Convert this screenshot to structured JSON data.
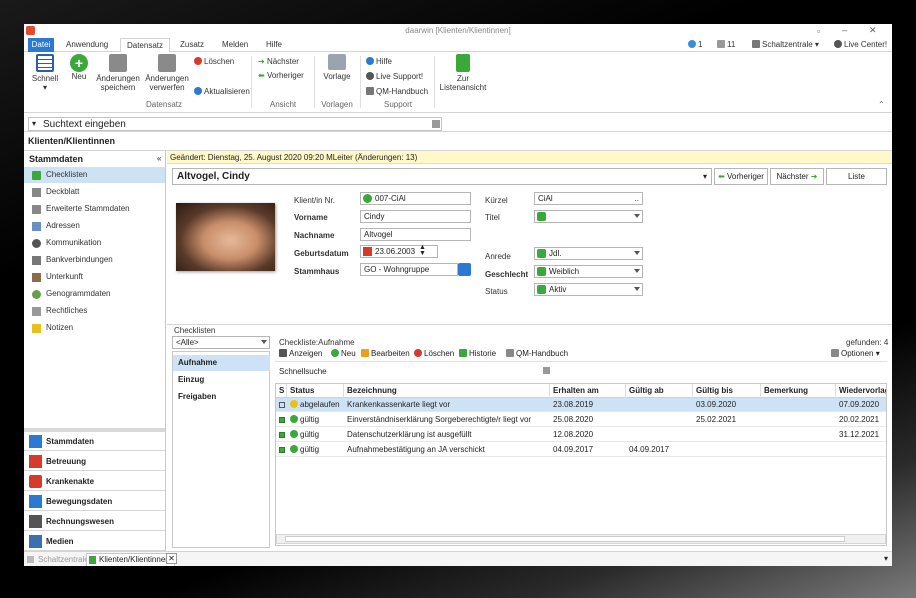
{
  "window": {
    "title": "daarwin [Klienten/Klientinnen]"
  },
  "ribbon_tabs": [
    "Datei",
    "Anwendung",
    "Datensatz",
    "Zusatz",
    "Melden",
    "Hilfe"
  ],
  "top_right": {
    "count1": "1",
    "count2": "11",
    "schaltzentrale": "Schaltzentrale",
    "live_center": "Live Center!"
  },
  "ribbon": {
    "schnell": "Schnell",
    "neu": "Neu",
    "aenderungen_speichern": "Änderungen speichern",
    "aenderungen_verwerfen": "Änderungen verwerfen",
    "loeschen": "Löschen",
    "aktualisieren": "Aktualisieren",
    "naechster": "Nächster",
    "vorheriger": "Vorheriger",
    "vorlage": "Vorlage",
    "hilfe": "Hilfe",
    "live_support": "Live Support!",
    "qm_handbuch": "QM-Handbuch",
    "zur_listenansicht": "Zur Listenansicht",
    "groups": {
      "datensatz": "Datensatz",
      "ansicht": "Ansicht",
      "vorlagen": "Vorlagen",
      "support": "Support"
    }
  },
  "search": {
    "placeholder": "Suchtext eingeben"
  },
  "module_title": "Klienten/Klientinnen",
  "sidebar": {
    "header": "Stammdaten",
    "items": [
      "Checklisten",
      "Deckblatt",
      "Erweiterte Stammdaten",
      "Adressen",
      "Kommunikation",
      "Bankverbindungen",
      "Unterkunft",
      "Genogrammdaten",
      "Rechtliches",
      "Notizen"
    ],
    "nav": [
      "Stammdaten",
      "Betreuung",
      "Krankenakte",
      "Bewegungsdaten",
      "Rechnungswesen",
      "Medien"
    ]
  },
  "changed_info": "Geändert: Dienstag, 25. August 2020 09:20  MLeiter  (Änderungen: 13)",
  "record": {
    "name": "Altvogel, Cindy",
    "vorheriger": "Vorheriger",
    "naechster": "Nächster",
    "liste": "Liste"
  },
  "form": {
    "klient_nr_label": "Klient/in Nr.",
    "klient_nr": "007-CiAl",
    "vorname_label": "Vorname",
    "vorname": "Cindy",
    "nachname_label": "Nachname",
    "nachname": "Altvogel",
    "geburtsdatum_label": "Geburtsdatum",
    "geburtsdatum": "23.06.2003",
    "stammhaus_label": "Stammhaus",
    "stammhaus": "GO - Wohngruppe",
    "kuerzel_label": "Kürzel",
    "kuerzel": "CiAl",
    "titel_label": "Titel",
    "titel": "",
    "anrede_label": "Anrede",
    "anrede": "Jdl.",
    "geschlecht_label": "Geschlecht",
    "geschlecht": "Weiblich",
    "status_label": "Status",
    "status": "Aktiv"
  },
  "checklisten": {
    "header": "Checklisten",
    "filter": "<Alle>",
    "categories": [
      "Aufnahme",
      "Einzug",
      "Freigaben"
    ],
    "panel_title": "Checkliste:Aufnahme",
    "found": "gefunden: 4",
    "toolbar": {
      "anzeigen": "Anzeigen",
      "neu": "Neu",
      "bearbeiten": "Bearbeiten",
      "loeschen": "Löschen",
      "historie": "Historie",
      "qm": "QM-Handbuch",
      "optionen": "Optionen"
    },
    "schnellsuche": "Schnellsuche",
    "columns": [
      "S",
      "Status",
      "Bezeichnung",
      "Erhalten am",
      "Gültig ab",
      "Gültig bis",
      "Bemerkung",
      "Wiedervorlage"
    ],
    "rows": [
      {
        "status": "abgelaufen",
        "color": "#e8c21a",
        "bezeichnung": "Krankenkassenkarte liegt vor",
        "erhalten": "23.08.2019",
        "gueltig_ab": "",
        "gueltig_bis": "03.09.2020",
        "bemerkung": "",
        "wiedervorlage": "07.09.2020"
      },
      {
        "status": "gültig",
        "color": "#3aa83a",
        "bezeichnung": "Einverständniserklärung Sorgeberechtigte/r liegt vor",
        "erhalten": "25.08.2020",
        "gueltig_ab": "",
        "gueltig_bis": "25.02.2021",
        "bemerkung": "",
        "wiedervorlage": "20.02.2021"
      },
      {
        "status": "gültig",
        "color": "#3aa83a",
        "bezeichnung": "Datenschutzerklärung ist ausgefüllt",
        "erhalten": "12.08.2020",
        "gueltig_ab": "",
        "gueltig_bis": "",
        "bemerkung": "",
        "wiedervorlage": "31.12.2021"
      },
      {
        "status": "gültig",
        "color": "#3aa83a",
        "bezeichnung": "Aufnahmebestätigung an JA verschickt",
        "erhalten": "04.09.2017",
        "gueltig_ab": "04.09.2017",
        "gueltig_bis": "",
        "bemerkung": "",
        "wiedervorlage": ""
      }
    ]
  },
  "statusbar": {
    "tab1": "Schaltzentrale",
    "tab2": "Klienten/Klientinnen"
  }
}
